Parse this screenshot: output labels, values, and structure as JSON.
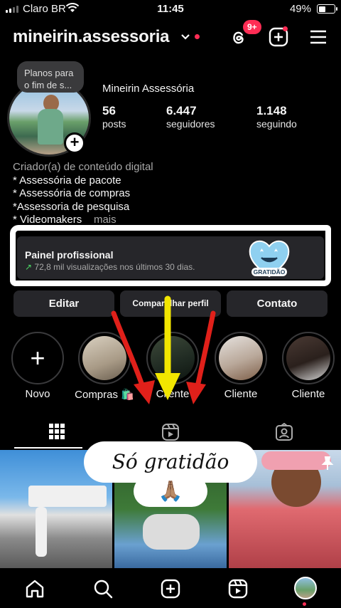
{
  "status_bar": {
    "carrier": "Claro BR",
    "time": "11:45",
    "battery": "49%",
    "battery_level": 0.49
  },
  "header": {
    "username": "mineirin.assessoria",
    "notification_badge": "9+"
  },
  "profile": {
    "note": "Planos para o fim de s...",
    "display_name": "Mineirin Assessória",
    "stats": [
      {
        "value": "56",
        "label": "posts"
      },
      {
        "value": "6.447",
        "label": "seguidores"
      },
      {
        "value": "1.148",
        "label": "seguindo"
      }
    ],
    "bio": {
      "category": "Criador(a) de conteúdo digital",
      "lines": [
        "* Assessória de pacote",
        "* Assessória de compras",
        "*Assessoria de pesquisa",
        "* Videomakers"
      ],
      "more": "mais"
    }
  },
  "pro_dashboard": {
    "title": "Painel profissional",
    "subtitle": "72,8 mil visualizações nos últimos 30 dias.",
    "sticker_text": "GRATIDÃO"
  },
  "buttons": {
    "edit": "Editar",
    "share": "Compartilhar perfil",
    "contact": "Contato"
  },
  "highlights": [
    {
      "label": "Novo"
    },
    {
      "label": "Compras 🛍️"
    },
    {
      "label": "Cliente"
    },
    {
      "label": "Cliente"
    },
    {
      "label": "Cliente"
    }
  ],
  "overlay": {
    "caption": "Só gratidão",
    "emoji": "🙏🏽"
  },
  "colors": {
    "accent_red": "#ff2d55",
    "arrow_red": "#e0201a",
    "arrow_yellow": "#f2e600",
    "panel": "#26262a"
  }
}
